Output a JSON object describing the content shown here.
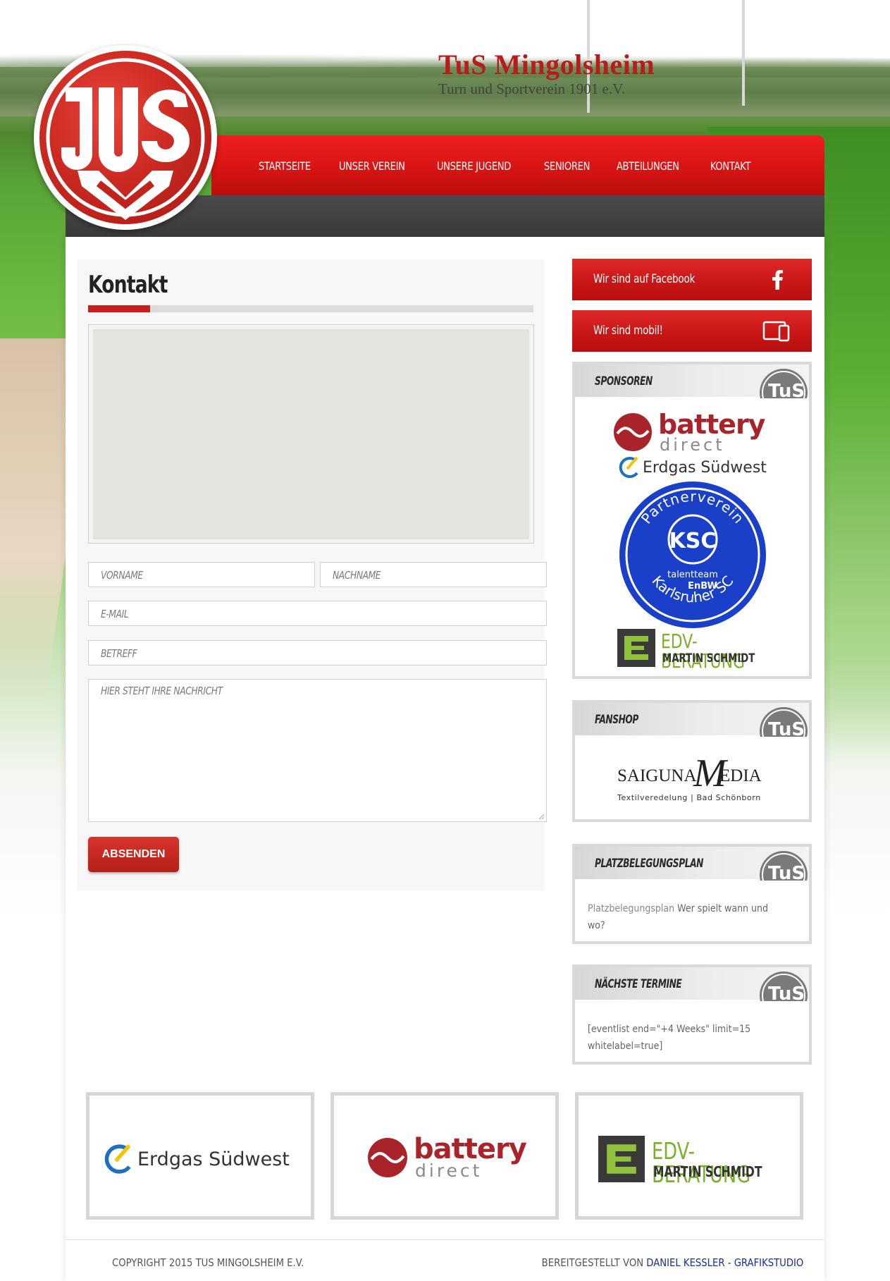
{
  "header": {
    "site_title": "TuS Mingolsheim",
    "site_subtitle": "Turn und Sportverein 1901 e.V."
  },
  "nav": {
    "items": [
      "STARTSEITE",
      "UNSER VEREIN",
      "UNSERE JUGEND",
      "SENIOREN",
      "ABTEILUNGEN",
      "KONTAKT"
    ]
  },
  "content": {
    "page_title": "Kontakt",
    "form": {
      "firstname_placeholder": "VORNAME",
      "lastname_placeholder": "NACHNAME",
      "email_placeholder": "E-MAIL",
      "subject_placeholder": "BETREFF",
      "message_placeholder": "HIER STEHT IHRE NACHRICHT",
      "submit_label": "ABSENDEN"
    }
  },
  "sidebar": {
    "facebook_label": "Wir sind auf Facebook",
    "mobile_label": "Wir sind mobil!",
    "sponsors": {
      "title": "SPONSOREN",
      "battery_word": "battery",
      "battery_sub": "direct",
      "erdgas": "Erdgas Südwest",
      "ksc_arc_top": "Partnerverein",
      "ksc_mark": "KSC",
      "ksc_talent": "talentteam",
      "ksc_enbw": "EnBW",
      "ksc_arc_bottom": "Karlsruher SC",
      "edv_word": "EDV-BERATUNG",
      "edv_name": "MARTIN SCHMIDT"
    },
    "fanshop": {
      "title": "FANSHOP",
      "brand_left": "SAIGUNA",
      "brand_m": "M",
      "brand_right": "EDIA",
      "tagline": "Textilveredelung | Bad Schönborn"
    },
    "platz": {
      "title": "PLATZBELEGUNGSPLAN",
      "link_text": "Platzbelegungsplan",
      "rest_text": " Wer spielt wann und wo?"
    },
    "termine": {
      "title": "NÄCHSTE TERMINE",
      "body": "[eventlist end=\"+4 Weeks\" limit=15 whitelabel=true]"
    }
  },
  "footer": {
    "sponsors": {
      "erdgas": "Erdgas Südwest",
      "battery_word": "battery",
      "battery_sub": "direct",
      "edv_word": "EDV-BERATUNG",
      "edv_name": "MARTIN SCHMIDT"
    },
    "copyright": "COPYRIGHT 2015 TUS MINGOLSHEIM E.V.",
    "credit_prefix": "BEREITGESTELLT VON ",
    "credit_link": "DANIEL KESSLER - GRAFIKSTUDIO"
  },
  "colors": {
    "brand_red": "#c81d1d",
    "dark_bar": "#3f3f3f",
    "link_blue": "#1c2c9c"
  }
}
